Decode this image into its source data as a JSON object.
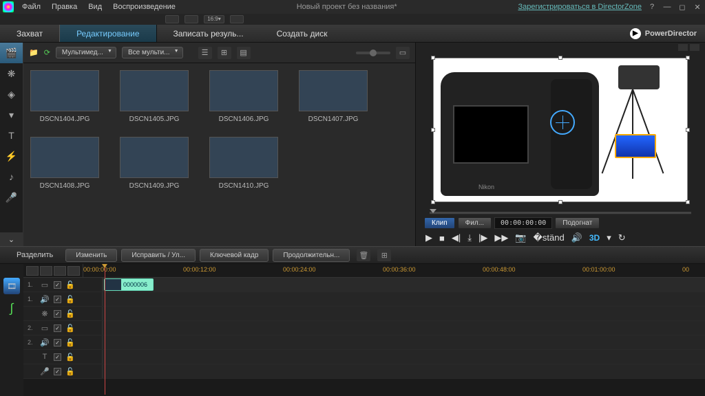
{
  "menu": {
    "file": "Файл",
    "edit": "Правка",
    "view": "Вид",
    "play": "Воспроизведение"
  },
  "title": "Новый проект без названия*",
  "dzlink": "Зарегистрироваться в DirectorZone",
  "brand": "PowerDirector",
  "modes": {
    "capture": "Захват",
    "edit": "Редактирование",
    "produce": "Записать резуль...",
    "disc": "Создать диск"
  },
  "mediadd1": "Мультимед...",
  "mediadd2": "Все мульти...",
  "thumbs": [
    {
      "name": "DSCN1404.JPG",
      "cls": "g1"
    },
    {
      "name": "DSCN1405.JPG",
      "cls": "g2"
    },
    {
      "name": "DSCN1406.JPG",
      "cls": "g3"
    },
    {
      "name": "DSCN1407.JPG",
      "cls": "g4"
    },
    {
      "name": "DSCN1408.JPG",
      "cls": "g5"
    },
    {
      "name": "DSCN1409.JPG",
      "cls": "g6"
    },
    {
      "name": "DSCN1410.JPG",
      "cls": "g7"
    }
  ],
  "cameraBrand": "Nikon",
  "preview": {
    "clip": "Клип",
    "film": "Фил...",
    "time": "00:00:00:00",
    "fit": "Подогнат"
  },
  "d3": "3D",
  "editbtns": {
    "split": "Разделить",
    "modify": "Изменить",
    "fix": "Исправить / Ул...",
    "keyframe": "Ключевой кадр",
    "duration": "Продолжительн..."
  },
  "ruler": [
    "00:00:00:00",
    "00:00:12:00",
    "00:00:24:00",
    "00:00:36:00",
    "00:00:48:00",
    "00:01:00:00",
    "00"
  ],
  "clipLabel": "0000006",
  "trackLabels": [
    "1.",
    "1.",
    "",
    "2.",
    "2.",
    "",
    ""
  ]
}
